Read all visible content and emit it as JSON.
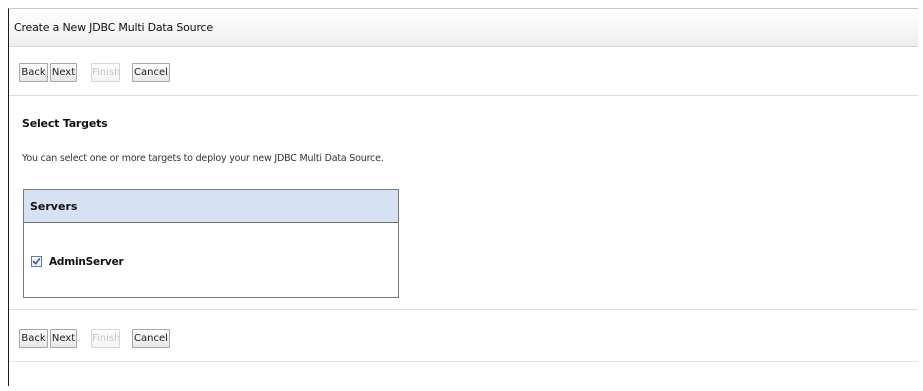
{
  "page": {
    "title": "Create a New JDBC Multi Data Source"
  },
  "toolbar_top": {
    "back_label": "Back",
    "next_label": "Next",
    "finish_label": "Finish",
    "cancel_label": "Cancel"
  },
  "main": {
    "section_title": "Select Targets",
    "description": "You can select one or more targets to deploy your new JDBC Multi Data Source.",
    "servers_table": {
      "header": "Servers",
      "rows": [
        {
          "name": "AdminServer",
          "checked": true
        }
      ]
    }
  },
  "toolbar_bottom": {
    "back_label": "Back",
    "next_label": "Next",
    "finish_label": "Finish",
    "cancel_label": "Cancel"
  },
  "icons": {
    "checkbox_check": "check-icon"
  },
  "colors": {
    "table_header_bg": "#d6e1f3",
    "checkbox_border": "#5a7bb0",
    "check_mark": "#2b4f8a"
  }
}
